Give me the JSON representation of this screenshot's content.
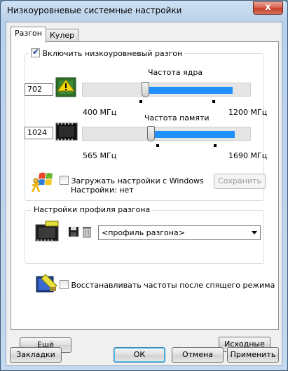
{
  "window": {
    "title": "Низкоуровневые системные настройки",
    "close_glyph": "x"
  },
  "tabs": [
    {
      "label": "Разгон",
      "active": true
    },
    {
      "label": "Кулер",
      "active": false
    }
  ],
  "overclock": {
    "enable_label": "Включить низкоуровневый разгон",
    "enable_checked": true,
    "core": {
      "label": "Частота ядра",
      "value": "702",
      "min_label": "400 МГц",
      "max_label": "1200 МГц",
      "min": 400,
      "max": 1200,
      "range_low": 702,
      "range_high": 1115
    },
    "memory": {
      "label": "Частота памяти",
      "value": "1024",
      "min_label": "565 МГц",
      "max_label": "1690 МГц",
      "min": 565,
      "max": 1690,
      "range_low": 1024,
      "range_high": 1585
    },
    "load_windows_label": "Загружать настройки с Windows",
    "load_windows_checked": false,
    "settings_status": "Настройки: нет",
    "save_label": "Сохранить"
  },
  "profile": {
    "group_label": "Настройки профиля разгона",
    "selected": "<профиль разгона>"
  },
  "restore_after_sleep_label": "Восстанавливать частоты после спящего режима",
  "restore_after_sleep_checked": false,
  "panel_buttons": {
    "more": "Ещё",
    "defaults": "Исходные"
  },
  "footer": {
    "bookmarks": "Закладки",
    "ok": "ОК",
    "cancel": "Отмена",
    "apply": "Применить"
  }
}
